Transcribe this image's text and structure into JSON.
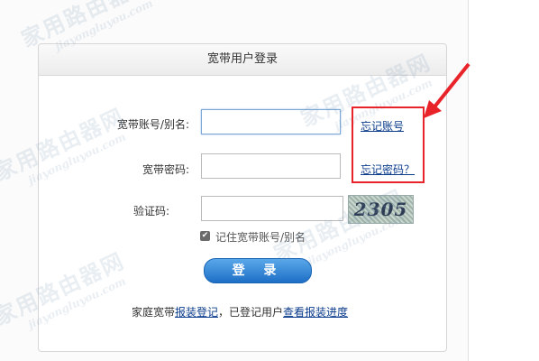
{
  "panel": {
    "title": "宽带用户登录"
  },
  "form": {
    "account_label": "宽带账号/别名:",
    "password_label": "宽带密码:",
    "captcha_label": "验证码:",
    "account_value": "",
    "password_value": "",
    "captcha_value": "",
    "captcha_text": "2305",
    "remember_label": "记住宽带账号/别名",
    "remember_checked": true
  },
  "links": {
    "forgot_account": "忘记账号",
    "forgot_password": "忘记密码？"
  },
  "login_button": "登 录",
  "footer": {
    "prefix": "家庭宽带",
    "register_link": "报装登记",
    "middle": "，已登记用户",
    "progress_link": "查看报装进度"
  },
  "watermark": {
    "cn": "家用路由器网",
    "en": "jiayongluyou.com"
  },
  "colors": {
    "annotation": "#e8232a",
    "button": "#1d6fc6",
    "link": "#0b3c8c"
  }
}
